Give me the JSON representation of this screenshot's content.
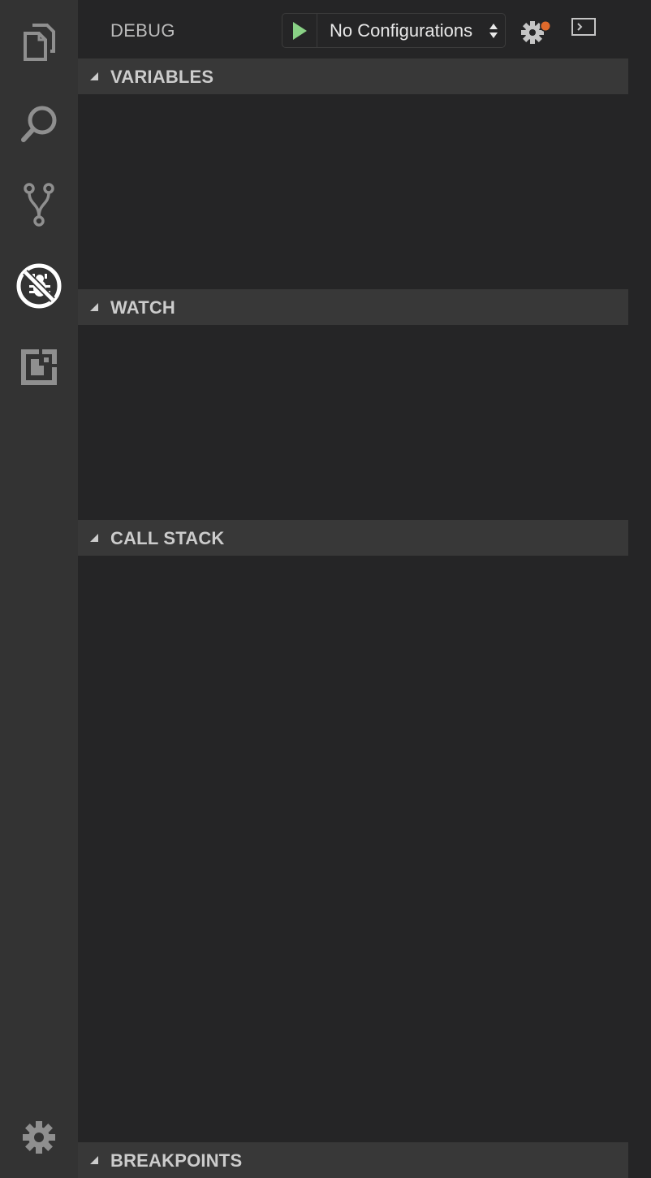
{
  "activity_bar": {
    "items": [
      {
        "name": "explorer",
        "icon": "files-icon"
      },
      {
        "name": "search",
        "icon": "search-icon"
      },
      {
        "name": "source-control",
        "icon": "git-branch-icon"
      },
      {
        "name": "debug",
        "icon": "debug-icon",
        "active": true
      },
      {
        "name": "extensions",
        "icon": "extensions-icon"
      }
    ],
    "bottom_icon": "gear-icon"
  },
  "header": {
    "title": "DEBUG",
    "configuration": "No Configurations",
    "start_icon": "play-icon",
    "settings_icon": "gear-icon",
    "console_icon": "terminal-icon"
  },
  "sections": [
    {
      "title": "VARIABLES"
    },
    {
      "title": "WATCH"
    },
    {
      "title": "CALL STACK"
    },
    {
      "title": "BREAKPOINTS"
    }
  ],
  "colors": {
    "activity_bar": "#333333",
    "sidebar": "#252526",
    "section_header": "#383838",
    "play_green": "#89d185",
    "badge_orange": "#e06a2c"
  }
}
